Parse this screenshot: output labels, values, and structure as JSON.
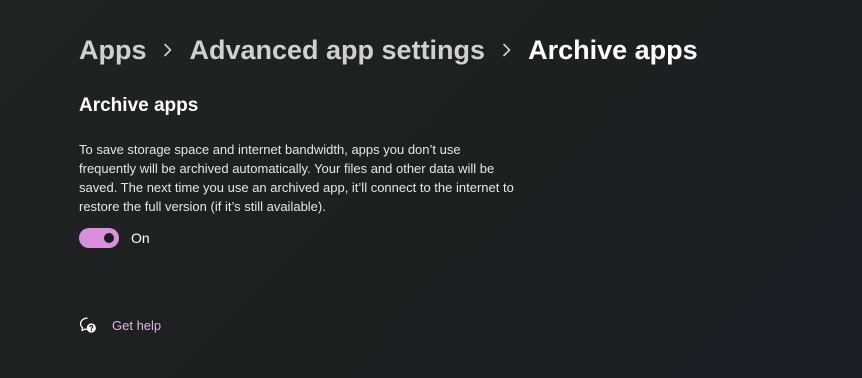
{
  "breadcrumb": {
    "items": [
      "Apps",
      "Advanced app settings"
    ],
    "current": "Archive apps"
  },
  "section": {
    "title": "Archive apps",
    "description": "To save storage space and internet bandwidth, apps you don’t use frequently will be archived automatically. Your files and other data will be saved. The next time you use an archived app, it’ll connect to the internet to restore the full version (if it’s still available)."
  },
  "toggle": {
    "state_label": "On",
    "checked": true
  },
  "help": {
    "label": "Get help",
    "icon": "get-help-icon"
  },
  "colors": {
    "accent": "#d98fdb",
    "link": "#e2b3e6",
    "background": "#1f2323"
  }
}
